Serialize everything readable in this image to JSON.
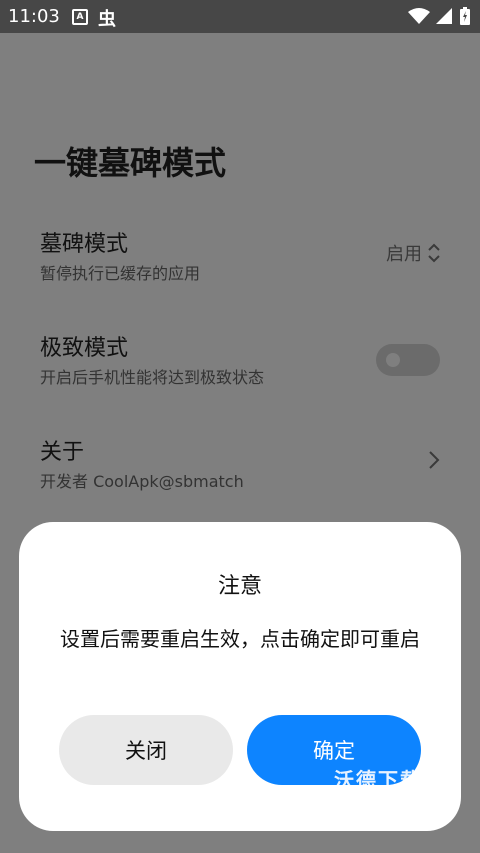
{
  "status_bar": {
    "time": "11:03",
    "icons": [
      "a-icon",
      "bug-icon",
      "wifi-icon",
      "signal-icon",
      "battery-icon"
    ]
  },
  "page": {
    "title": "一键墓碑模式"
  },
  "settings": [
    {
      "title": "墓碑模式",
      "subtitle": "暂停执行已缓存的应用",
      "value": "启用"
    },
    {
      "title": "极致模式",
      "subtitle": "开启后手机性能将达到极致状态",
      "toggle_on": false
    },
    {
      "title": "关于",
      "subtitle": "开发者 CoolApk@sbmatch"
    }
  ],
  "dialog": {
    "title": "注意",
    "message": "设置后需要重启生效，点击确定即可重启",
    "close_label": "关闭",
    "ok_label": "确定"
  },
  "watermark": "沃德下载",
  "colors": {
    "accent": "#0d84ff",
    "scrim": "#7f7f7f",
    "statusbar": "#474747"
  }
}
